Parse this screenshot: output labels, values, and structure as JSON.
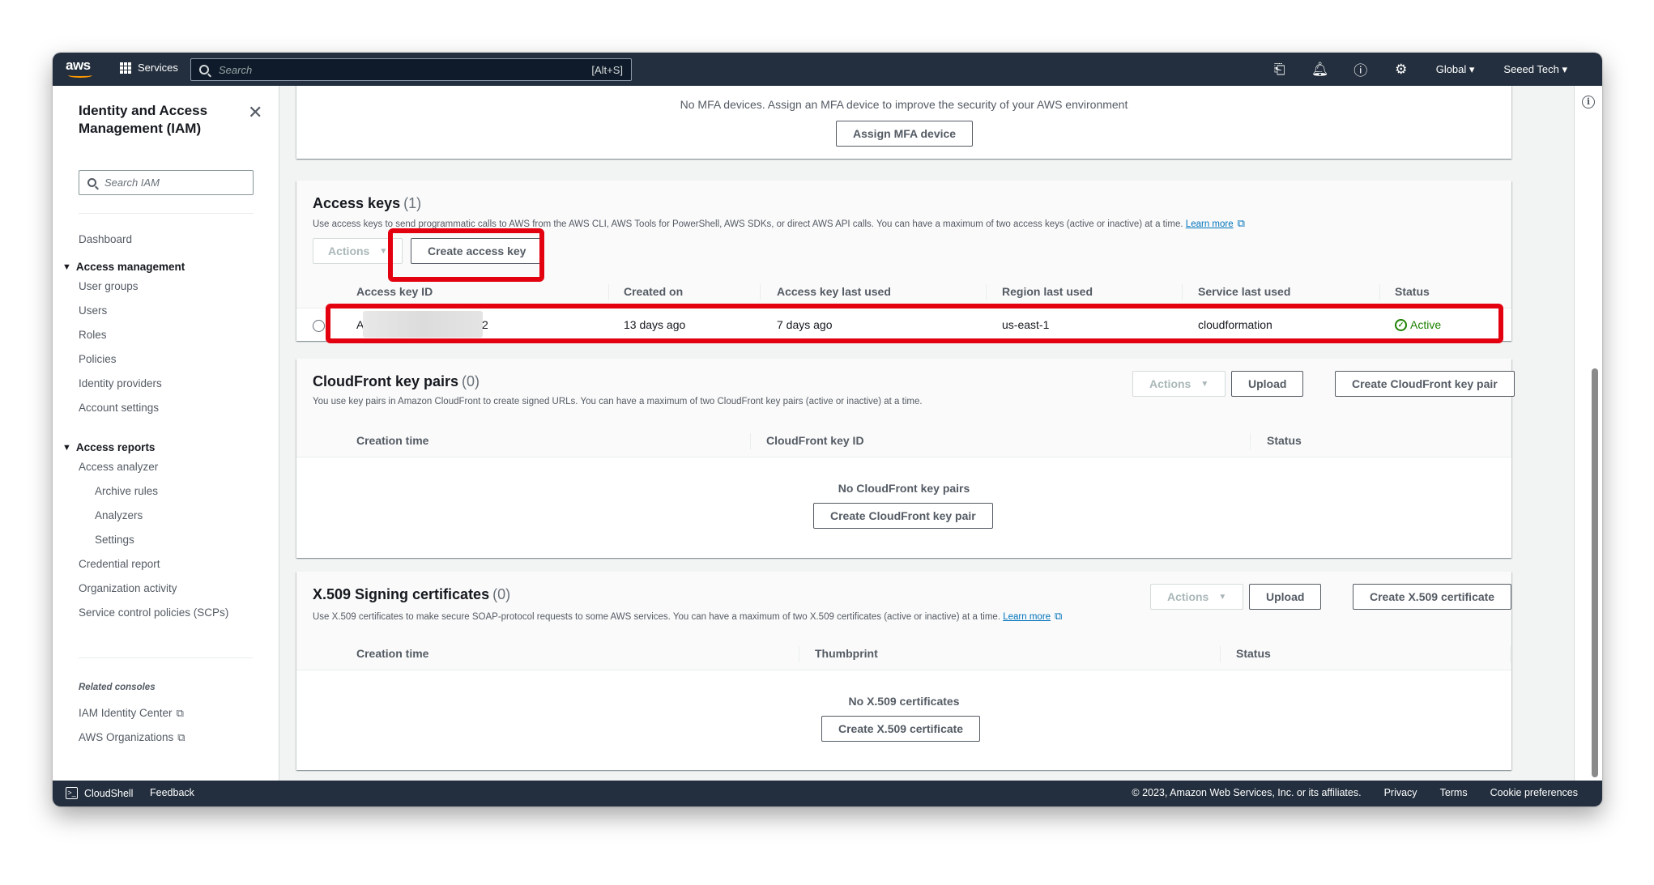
{
  "topnav": {
    "logo": "aws",
    "services": "Services",
    "search_placeholder": "Search",
    "search_shortcut": "[Alt+S]",
    "region": "Global ▾",
    "account": "Seeed Tech ▾",
    "icons": [
      "cloudshell-icon",
      "bell-icon",
      "help-icon",
      "gear-icon"
    ]
  },
  "sidebar": {
    "title": "Identity and Access Management (IAM)",
    "search_placeholder": "Search IAM",
    "dashboard": "Dashboard",
    "access_management": {
      "label": "Access management",
      "items": [
        "User groups",
        "Users",
        "Roles",
        "Policies",
        "Identity providers",
        "Account settings"
      ]
    },
    "access_reports": {
      "label": "Access reports",
      "analyzer": "Access analyzer",
      "analyzer_items": [
        "Archive rules",
        "Analyzers",
        "Settings"
      ],
      "items": [
        "Credential report",
        "Organization activity",
        "Service control policies (SCPs)"
      ]
    },
    "related_label": "Related consoles",
    "related": [
      "IAM Identity Center",
      "AWS Organizations"
    ]
  },
  "mfa": {
    "text": "No MFA devices. Assign an MFA device to improve the security of your AWS environment",
    "button": "Assign MFA device"
  },
  "access_keys": {
    "title": "Access keys",
    "count": "(1)",
    "desc": "Use access keys to send programmatic calls to AWS from the AWS CLI, AWS Tools for PowerShell, AWS SDKs, or direct AWS API calls. You can have a maximum of two access keys (active or inactive) at a time.",
    "learn_more": "Learn more",
    "actions": "Actions",
    "create": "Create access key",
    "columns": [
      "Access key ID",
      "Created on",
      "Access key last used",
      "Region last used",
      "Service last used",
      "Status"
    ],
    "row": {
      "key_prefix": "A",
      "key_suffix": "2",
      "created": "13 days ago",
      "last_used": "7 days ago",
      "region": "us-east-1",
      "service": "cloudformation",
      "status": "Active"
    }
  },
  "cloudfront": {
    "title": "CloudFront key pairs",
    "count": "(0)",
    "desc": "You use key pairs in Amazon CloudFront to create signed URLs. You can have a maximum of two CloudFront key pairs (active or inactive) at a time.",
    "actions": "Actions",
    "upload": "Upload",
    "create": "Create CloudFront key pair",
    "columns": [
      "Creation time",
      "CloudFront key ID",
      "Status"
    ],
    "empty": "No CloudFront key pairs",
    "empty_button": "Create CloudFront key pair"
  },
  "x509": {
    "title": "X.509 Signing certificates",
    "count": "(0)",
    "desc": "Use X.509 certificates to make secure SOAP-protocol requests to some AWS services. You can have a maximum of two X.509 certificates (active or inactive) at a time.",
    "learn_more": "Learn more",
    "actions": "Actions",
    "upload": "Upload",
    "create": "Create X.509 certificate",
    "columns": [
      "Creation time",
      "Thumbprint",
      "Status"
    ],
    "empty": "No X.509 certificates",
    "empty_button": "Create X.509 certificate"
  },
  "footer": {
    "cloudshell": "CloudShell",
    "feedback": "Feedback",
    "copyright": "© 2023, Amazon Web Services, Inc. or its affiliates.",
    "privacy": "Privacy",
    "terms": "Terms",
    "cookies": "Cookie preferences"
  },
  "colors": {
    "nav": "#232f3e",
    "accent": "#ff9900",
    "highlight": "#e3000f",
    "active": "#1d8102",
    "link": "#0073bb"
  }
}
